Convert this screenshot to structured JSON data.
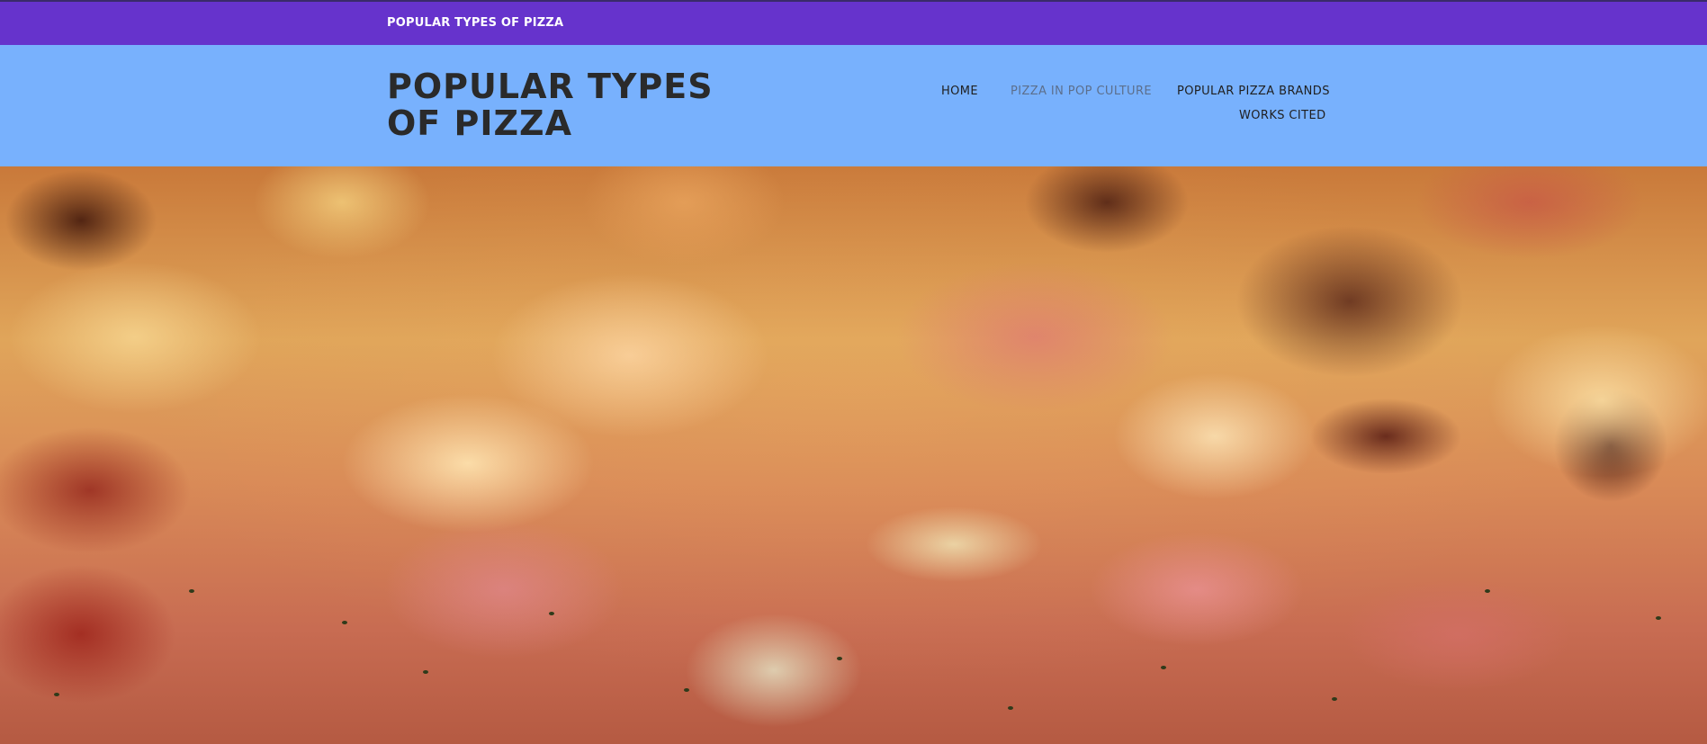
{
  "top_bar": {
    "title": "POPULAR TYPES OF PIZZA",
    "background_color": "#6633cc"
  },
  "header": {
    "site_title": "POPULAR TYPES OF PIZZA",
    "background_color": "#78b1fd",
    "nav": [
      {
        "label": "HOME",
        "active": false
      },
      {
        "label": "PIZZA IN POP CULTURE",
        "active": true
      },
      {
        "label": "POPULAR PIZZA BRANDS",
        "active": false
      },
      {
        "label": "WORKS CITED",
        "active": false
      }
    ]
  },
  "hero": {
    "image": "pizza-closeup-photo"
  }
}
